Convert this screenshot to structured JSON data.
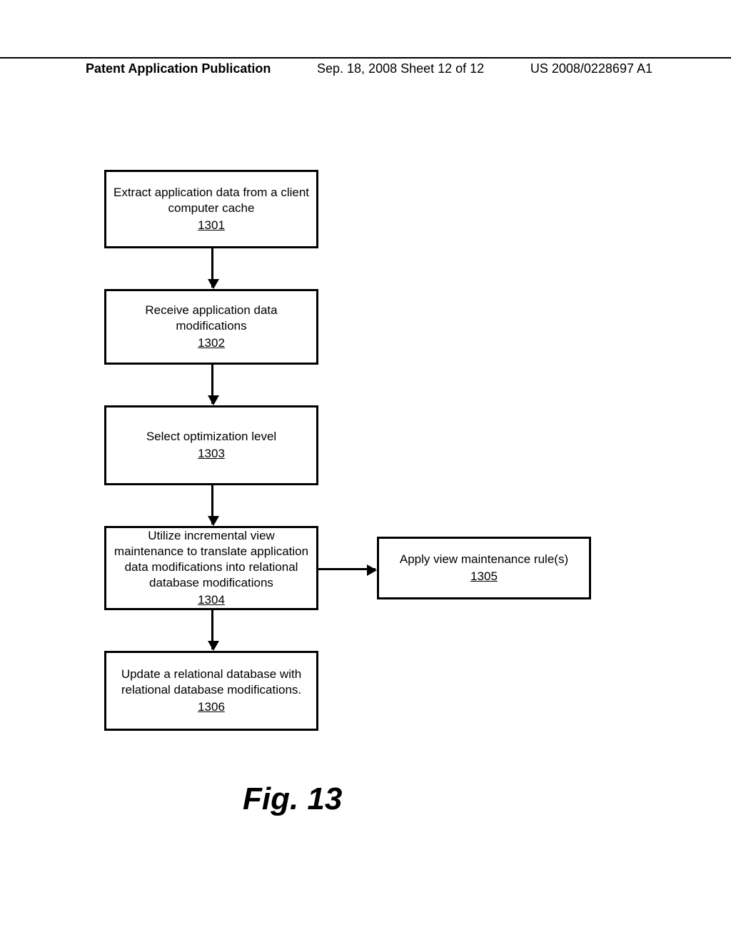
{
  "header": {
    "left": "Patent Application Publication",
    "mid": "Sep. 18, 2008  Sheet 12 of 12",
    "right": "US 2008/0228697 A1"
  },
  "boxes": {
    "b1": {
      "text": "Extract application data from a client computer cache",
      "ref": "1301"
    },
    "b2": {
      "text": "Receive application data modifications",
      "ref": "1302"
    },
    "b3": {
      "text": "Select optimization level",
      "ref": "1303"
    },
    "b4": {
      "text": "Utilize incremental view maintenance to translate application data modifications into relational database modifications",
      "ref": "1304"
    },
    "b5": {
      "text": "Apply view maintenance rule(s)",
      "ref": "1305"
    },
    "b6": {
      "text": "Update a relational database with relational database modifications.",
      "ref": "1306"
    }
  },
  "figure_label": "Fig. 13"
}
